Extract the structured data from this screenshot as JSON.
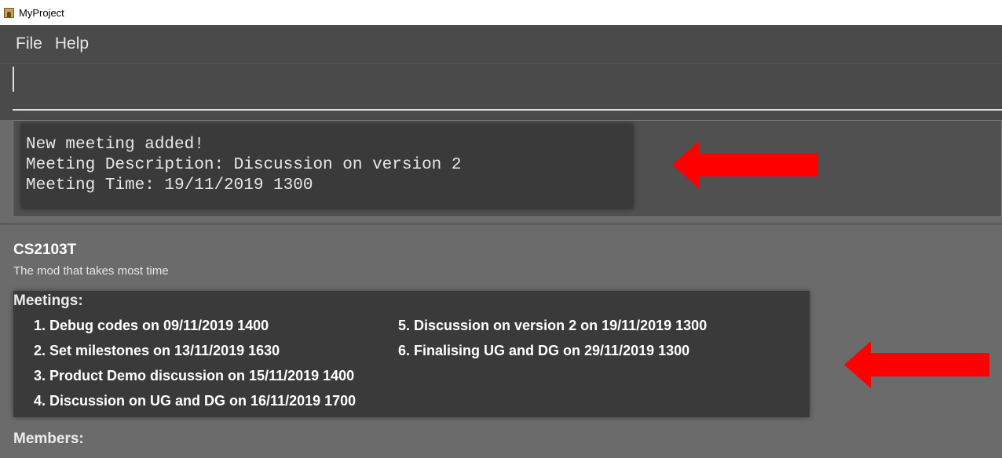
{
  "window": {
    "title": "MyProject"
  },
  "menu": {
    "items": [
      "File",
      "Help"
    ]
  },
  "command": {
    "value": ""
  },
  "result": {
    "lines": [
      "New meeting added!",
      "Meeting Description: Discussion on version 2",
      "Meeting Time: 19/11/2019 1300"
    ]
  },
  "project": {
    "title": "CS2103T",
    "description": "The mod that takes most time",
    "meetings_label": "Meetings:",
    "meetings": [
      "1. Debug codes on 09/11/2019 1400",
      "2. Set milestones on 13/11/2019 1630",
      "3. Product Demo discussion on 15/11/2019 1400",
      "4. Discussion on UG and DG on 16/11/2019 1700",
      "5. Discussion on version 2 on 19/11/2019 1300",
      "6. Finalising UG and DG on 29/11/2019 1300"
    ],
    "members_label": "Members:"
  },
  "colors": {
    "arrow": "#ff0000",
    "background": "#6b6b6b",
    "panel": "#3a3a3a"
  }
}
